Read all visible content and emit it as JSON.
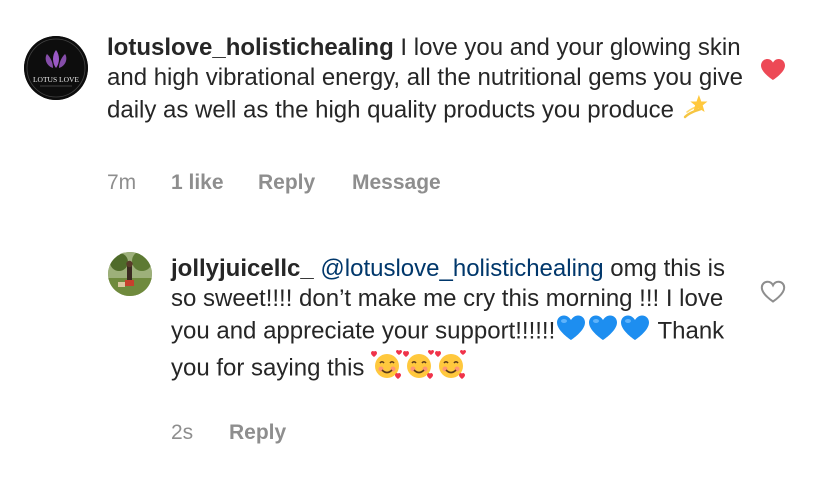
{
  "comments": [
    {
      "username": "lotuslove_holistichealing",
      "avatar_text": "LOTUS LOVE",
      "text": " I love you and your glowing skin and high vibrational energy, all the nutritional gems you give daily as well as the high quality products you produce ",
      "emoji": "dizzy-star-emoji",
      "time": "7m",
      "likes": "1 like",
      "reply_label": "Reply",
      "message_label": "Message",
      "liked": true
    },
    {
      "username": "jollyjuicellc_",
      "mention": "@lotuslove_holistichealing",
      "text_a": " omg this is so sweet!!!! don’t make me cry this morning !!! I love you and appreciate your support!!!!!!",
      "text_b": " Thank you for saying this ",
      "emojis_a": [
        "blue-heart-emoji",
        "blue-heart-emoji",
        "blue-heart-emoji"
      ],
      "emojis_b": [
        "smiling-face-with-hearts-emoji",
        "smiling-face-with-hearts-emoji",
        "smiling-face-with-hearts-emoji"
      ],
      "time": "2s",
      "reply_label": "Reply",
      "liked": false
    }
  ],
  "colors": {
    "text": "#262626",
    "meta": "#8e8e8e",
    "mention": "#00376b",
    "like_red": "#ed4956"
  }
}
